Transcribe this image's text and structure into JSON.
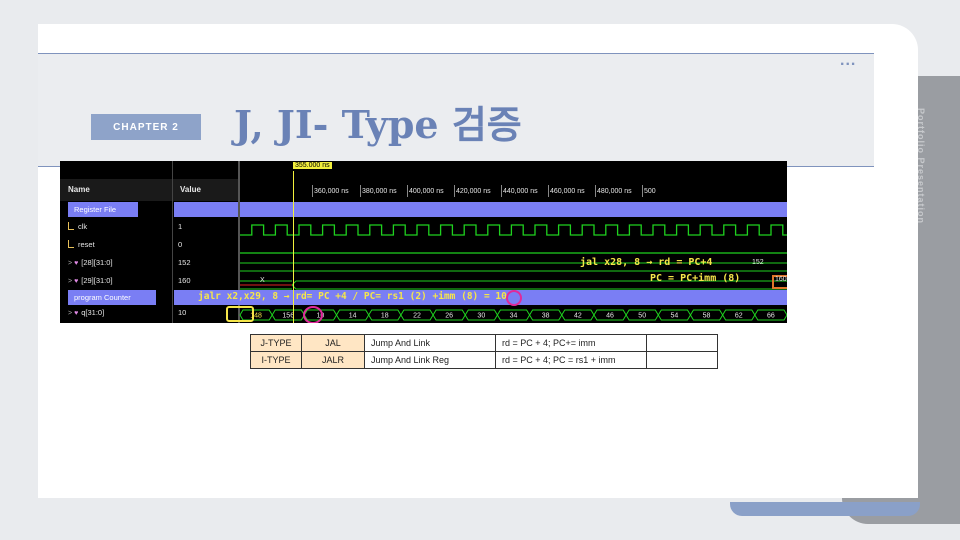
{
  "slide": {
    "chapter": "CHAPTER 2",
    "title": "J, JI- Type 검증",
    "dots": "...",
    "side_tab_text": "Portfolio Presentation"
  },
  "waveform": {
    "cursor_time": "355.000 ns",
    "header": {
      "name": "Name",
      "value": "Value"
    },
    "time_ticks": [
      "360,000 ns",
      "380,000 ns",
      "400,000 ns",
      "420,000 ns",
      "440,000 ns",
      "460,000 ns",
      "480,000 ns",
      "500"
    ],
    "signals": [
      {
        "name": "Register File",
        "value": "",
        "kind": "group"
      },
      {
        "name": "clk",
        "value": "1",
        "kind": "bit"
      },
      {
        "name": "reset",
        "value": "0",
        "kind": "bit"
      },
      {
        "name": "[28][31:0]",
        "value": "152",
        "kind": "bus"
      },
      {
        "name": "[29][31:0]",
        "value": "160",
        "kind": "bus"
      },
      {
        "name": "program Counter",
        "value": "",
        "kind": "group"
      },
      {
        "name": "q[31:0]",
        "value": "10",
        "kind": "bus"
      }
    ],
    "reg29_start": "X",
    "reg28_value_label": "152",
    "reg29_value_label": "160",
    "pc_values": [
      "148",
      "156",
      "10",
      "14",
      "18",
      "22",
      "26",
      "30",
      "34",
      "38",
      "42",
      "46",
      "50",
      "54",
      "58",
      "62",
      "66"
    ],
    "annotations": {
      "jal_line": "jal x28, 8 → rd = PC+4",
      "pc_line": "PC = PC+imm (8)",
      "jalr_line": "jalr x2,x29, 8 → rd= PC +4 / PC= rs1 (2) +imm (8) = 10"
    }
  },
  "table": {
    "rows": [
      {
        "type": "J-TYPE",
        "mnemonic": "JAL",
        "name": "Jump  And  Link",
        "desc": "rd = PC + 4;  PC+= imm",
        "extra": ""
      },
      {
        "type": "I-TYPE",
        "mnemonic": "JALR",
        "name": "Jump  And  Link  Reg",
        "desc": "rd = PC + 4;  PC = rs1 + imm",
        "extra": ""
      }
    ]
  },
  "colors": {
    "accent": "#6a82b6",
    "badge": "#8ea3c9",
    "group_bar": "#7a7ef4",
    "wave_green": "#1fd11f",
    "cursor": "#f2ef3c",
    "highlight_circle": "#e02a9a",
    "highlight_box": "#e0762a"
  }
}
